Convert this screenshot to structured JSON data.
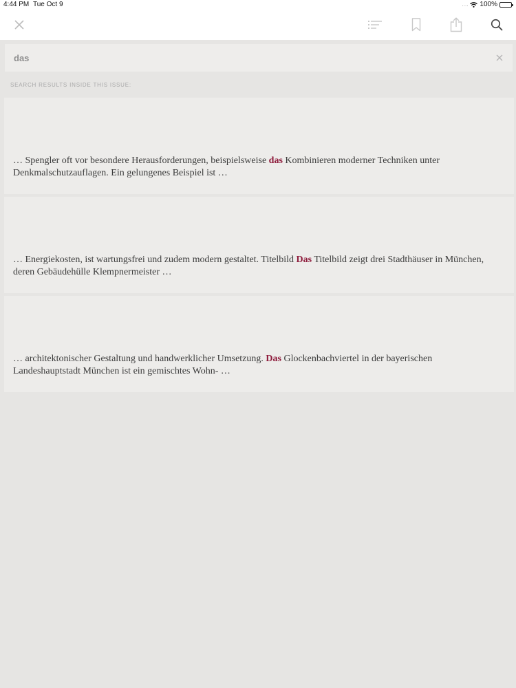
{
  "status_bar": {
    "time": "4:44 PM",
    "date": "Tue Oct 9",
    "signal": "....",
    "battery": "100%"
  },
  "toolbar": {
    "icons": {
      "close": "close-icon",
      "toc": "list-icon",
      "bookmark": "bookmark-icon",
      "share": "share-icon",
      "search": "search-icon"
    }
  },
  "search": {
    "value": "das",
    "clear_icon": "close-icon"
  },
  "results": {
    "label": "SEARCH RESULTS INSIDE THIS ISSUE:",
    "items": [
      {
        "before": "… Spengler oft vor besondere Herausforderungen, beispielsweise ",
        "match": "das",
        "after": " Kombinieren moderner Techniken unter Denkmalschutzauflagen. Ein gelungenes Beispiel ist …"
      },
      {
        "before": "… Energiekosten, ist wartungsfrei und zudem modern gestaltet. Titelbild ",
        "match": "Das",
        "after": " Titelbild zeigt drei Stadthäuser in München, deren Gebäudehülle Klempnermeister …"
      },
      {
        "before": "… architektonischer Gestaltung und handwerklicher Umsetzung. ",
        "match": "Das",
        "after": " Glockenbachviertel in der bayerischen Landeshauptstadt München ist ein gemischtes Wohn- …"
      }
    ]
  },
  "colors": {
    "highlight": "#8e1c3c",
    "background": "#e6e5e3",
    "card": "#edecea",
    "toolbar": "#ffffff"
  }
}
